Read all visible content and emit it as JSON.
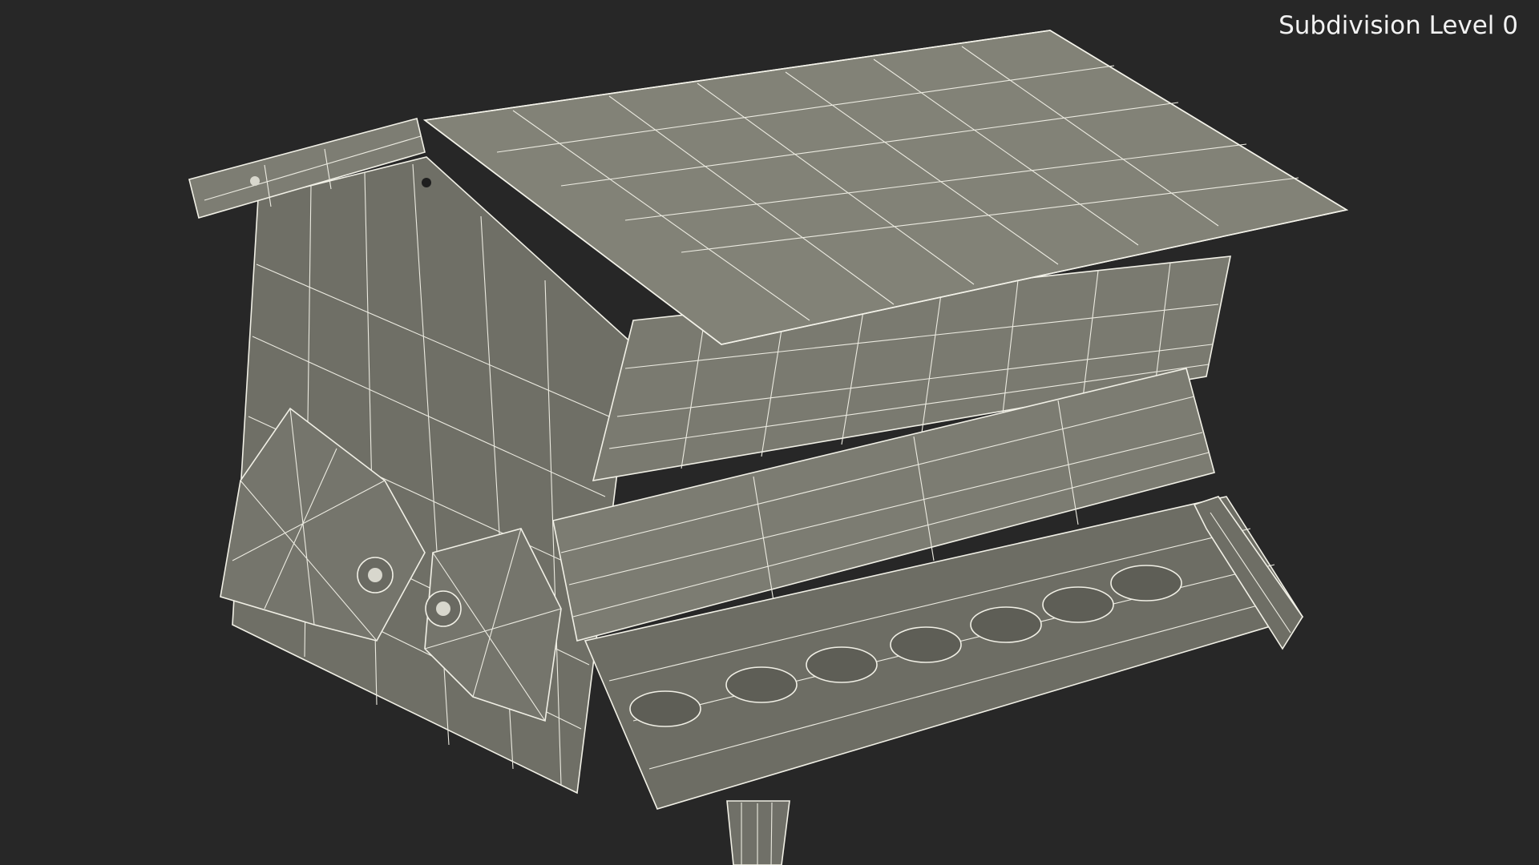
{
  "viewport": {
    "overlay_label": "Subdivision Level 0",
    "background_color": "#272727",
    "mesh_color": "#7a7a70",
    "wire_color": "#ecebe1"
  },
  "model": {
    "icon": "bird-feeder-wireframe-model"
  }
}
